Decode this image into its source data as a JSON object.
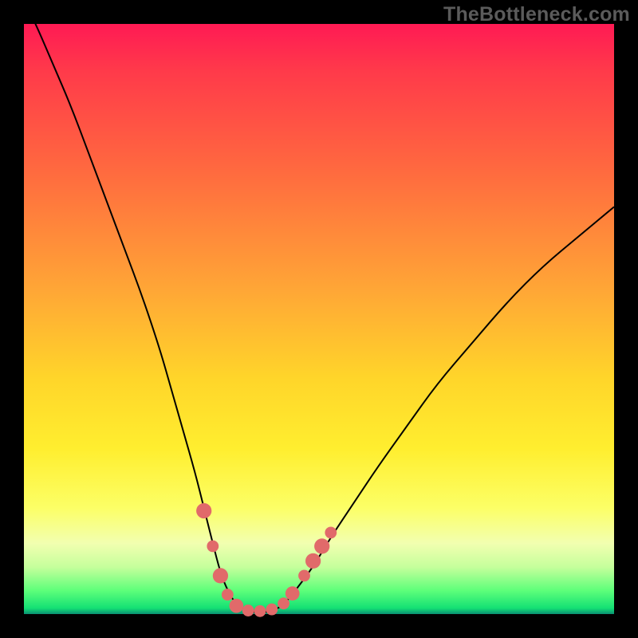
{
  "watermark": "TheBottleneck.com",
  "chart_data": {
    "type": "line",
    "title": "",
    "xlabel": "",
    "ylabel": "",
    "xlim": [
      0,
      100
    ],
    "ylim": [
      0,
      100
    ],
    "gradient_stops": [
      {
        "pos": 0,
        "color": "#ff1a54"
      },
      {
        "pos": 8,
        "color": "#ff3a4a"
      },
      {
        "pos": 25,
        "color": "#ff6a3f"
      },
      {
        "pos": 45,
        "color": "#ffa636"
      },
      {
        "pos": 60,
        "color": "#ffd52a"
      },
      {
        "pos": 72,
        "color": "#ffee2f"
      },
      {
        "pos": 82,
        "color": "#fcff66"
      },
      {
        "pos": 88,
        "color": "#f2ffb0"
      },
      {
        "pos": 92,
        "color": "#c6ff9c"
      },
      {
        "pos": 96,
        "color": "#5eff7a"
      },
      {
        "pos": 99,
        "color": "#14e074"
      },
      {
        "pos": 100,
        "color": "#0a8f73"
      }
    ],
    "series": [
      {
        "name": "bottleneck-curve",
        "x": [
          0,
          2,
          5,
          8,
          11,
          14,
          17,
          20,
          23,
          25,
          27,
          29,
          30.5,
          32,
          33.3,
          34.5,
          36,
          38,
          40,
          42,
          44,
          46,
          49,
          52,
          56,
          60,
          65,
          70,
          76,
          82,
          88,
          94,
          100
        ],
        "y": [
          104,
          100,
          93,
          86,
          78,
          70,
          62,
          54,
          45,
          38,
          31,
          24,
          18,
          12,
          7,
          4,
          1.5,
          0.5,
          0.2,
          0.5,
          1.5,
          4,
          8,
          13,
          19,
          25,
          32,
          39,
          46,
          53,
          59,
          64,
          69
        ]
      }
    ],
    "markers": {
      "name": "highlight-points",
      "points": [
        {
          "x": 30.5,
          "y": 17.5,
          "r": 1.3
        },
        {
          "x": 32.0,
          "y": 11.5,
          "r": 1.0
        },
        {
          "x": 33.3,
          "y": 6.5,
          "r": 1.3
        },
        {
          "x": 34.5,
          "y": 3.3,
          "r": 1.0
        },
        {
          "x": 36.0,
          "y": 1.4,
          "r": 1.2
        },
        {
          "x": 38.0,
          "y": 0.6,
          "r": 1.0
        },
        {
          "x": 40.0,
          "y": 0.5,
          "r": 1.0
        },
        {
          "x": 42.0,
          "y": 0.8,
          "r": 1.0
        },
        {
          "x": 44.0,
          "y": 1.8,
          "r": 1.0
        },
        {
          "x": 45.5,
          "y": 3.5,
          "r": 1.2
        },
        {
          "x": 47.5,
          "y": 6.5,
          "r": 1.0
        },
        {
          "x": 49.0,
          "y": 9.0,
          "r": 1.3
        },
        {
          "x": 50.5,
          "y": 11.5,
          "r": 1.3
        },
        {
          "x": 52.0,
          "y": 13.8,
          "r": 1.0
        }
      ]
    }
  }
}
